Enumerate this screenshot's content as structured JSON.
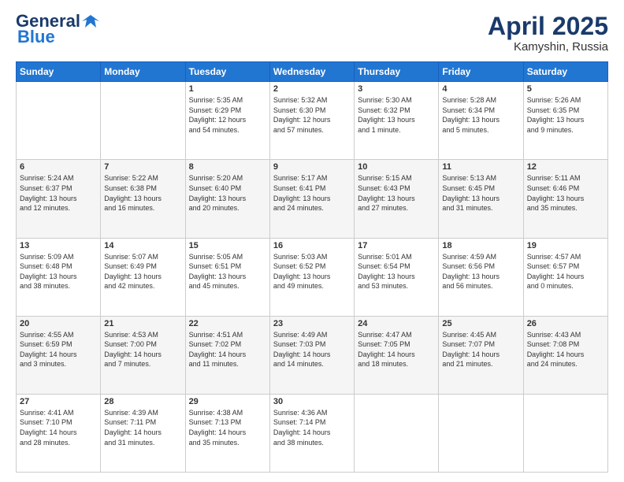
{
  "logo": {
    "general": "General",
    "blue": "Blue"
  },
  "header": {
    "month": "April 2025",
    "location": "Kamyshin, Russia"
  },
  "weekdays": [
    "Sunday",
    "Monday",
    "Tuesday",
    "Wednesday",
    "Thursday",
    "Friday",
    "Saturday"
  ],
  "weeks": [
    [
      {
        "day": "",
        "info": ""
      },
      {
        "day": "",
        "info": ""
      },
      {
        "day": "1",
        "info": "Sunrise: 5:35 AM\nSunset: 6:29 PM\nDaylight: 12 hours\nand 54 minutes."
      },
      {
        "day": "2",
        "info": "Sunrise: 5:32 AM\nSunset: 6:30 PM\nDaylight: 12 hours\nand 57 minutes."
      },
      {
        "day": "3",
        "info": "Sunrise: 5:30 AM\nSunset: 6:32 PM\nDaylight: 13 hours\nand 1 minute."
      },
      {
        "day": "4",
        "info": "Sunrise: 5:28 AM\nSunset: 6:34 PM\nDaylight: 13 hours\nand 5 minutes."
      },
      {
        "day": "5",
        "info": "Sunrise: 5:26 AM\nSunset: 6:35 PM\nDaylight: 13 hours\nand 9 minutes."
      }
    ],
    [
      {
        "day": "6",
        "info": "Sunrise: 5:24 AM\nSunset: 6:37 PM\nDaylight: 13 hours\nand 12 minutes."
      },
      {
        "day": "7",
        "info": "Sunrise: 5:22 AM\nSunset: 6:38 PM\nDaylight: 13 hours\nand 16 minutes."
      },
      {
        "day": "8",
        "info": "Sunrise: 5:20 AM\nSunset: 6:40 PM\nDaylight: 13 hours\nand 20 minutes."
      },
      {
        "day": "9",
        "info": "Sunrise: 5:17 AM\nSunset: 6:41 PM\nDaylight: 13 hours\nand 24 minutes."
      },
      {
        "day": "10",
        "info": "Sunrise: 5:15 AM\nSunset: 6:43 PM\nDaylight: 13 hours\nand 27 minutes."
      },
      {
        "day": "11",
        "info": "Sunrise: 5:13 AM\nSunset: 6:45 PM\nDaylight: 13 hours\nand 31 minutes."
      },
      {
        "day": "12",
        "info": "Sunrise: 5:11 AM\nSunset: 6:46 PM\nDaylight: 13 hours\nand 35 minutes."
      }
    ],
    [
      {
        "day": "13",
        "info": "Sunrise: 5:09 AM\nSunset: 6:48 PM\nDaylight: 13 hours\nand 38 minutes."
      },
      {
        "day": "14",
        "info": "Sunrise: 5:07 AM\nSunset: 6:49 PM\nDaylight: 13 hours\nand 42 minutes."
      },
      {
        "day": "15",
        "info": "Sunrise: 5:05 AM\nSunset: 6:51 PM\nDaylight: 13 hours\nand 45 minutes."
      },
      {
        "day": "16",
        "info": "Sunrise: 5:03 AM\nSunset: 6:52 PM\nDaylight: 13 hours\nand 49 minutes."
      },
      {
        "day": "17",
        "info": "Sunrise: 5:01 AM\nSunset: 6:54 PM\nDaylight: 13 hours\nand 53 minutes."
      },
      {
        "day": "18",
        "info": "Sunrise: 4:59 AM\nSunset: 6:56 PM\nDaylight: 13 hours\nand 56 minutes."
      },
      {
        "day": "19",
        "info": "Sunrise: 4:57 AM\nSunset: 6:57 PM\nDaylight: 14 hours\nand 0 minutes."
      }
    ],
    [
      {
        "day": "20",
        "info": "Sunrise: 4:55 AM\nSunset: 6:59 PM\nDaylight: 14 hours\nand 3 minutes."
      },
      {
        "day": "21",
        "info": "Sunrise: 4:53 AM\nSunset: 7:00 PM\nDaylight: 14 hours\nand 7 minutes."
      },
      {
        "day": "22",
        "info": "Sunrise: 4:51 AM\nSunset: 7:02 PM\nDaylight: 14 hours\nand 11 minutes."
      },
      {
        "day": "23",
        "info": "Sunrise: 4:49 AM\nSunset: 7:03 PM\nDaylight: 14 hours\nand 14 minutes."
      },
      {
        "day": "24",
        "info": "Sunrise: 4:47 AM\nSunset: 7:05 PM\nDaylight: 14 hours\nand 18 minutes."
      },
      {
        "day": "25",
        "info": "Sunrise: 4:45 AM\nSunset: 7:07 PM\nDaylight: 14 hours\nand 21 minutes."
      },
      {
        "day": "26",
        "info": "Sunrise: 4:43 AM\nSunset: 7:08 PM\nDaylight: 14 hours\nand 24 minutes."
      }
    ],
    [
      {
        "day": "27",
        "info": "Sunrise: 4:41 AM\nSunset: 7:10 PM\nDaylight: 14 hours\nand 28 minutes."
      },
      {
        "day": "28",
        "info": "Sunrise: 4:39 AM\nSunset: 7:11 PM\nDaylight: 14 hours\nand 31 minutes."
      },
      {
        "day": "29",
        "info": "Sunrise: 4:38 AM\nSunset: 7:13 PM\nDaylight: 14 hours\nand 35 minutes."
      },
      {
        "day": "30",
        "info": "Sunrise: 4:36 AM\nSunset: 7:14 PM\nDaylight: 14 hours\nand 38 minutes."
      },
      {
        "day": "",
        "info": ""
      },
      {
        "day": "",
        "info": ""
      },
      {
        "day": "",
        "info": ""
      }
    ]
  ]
}
